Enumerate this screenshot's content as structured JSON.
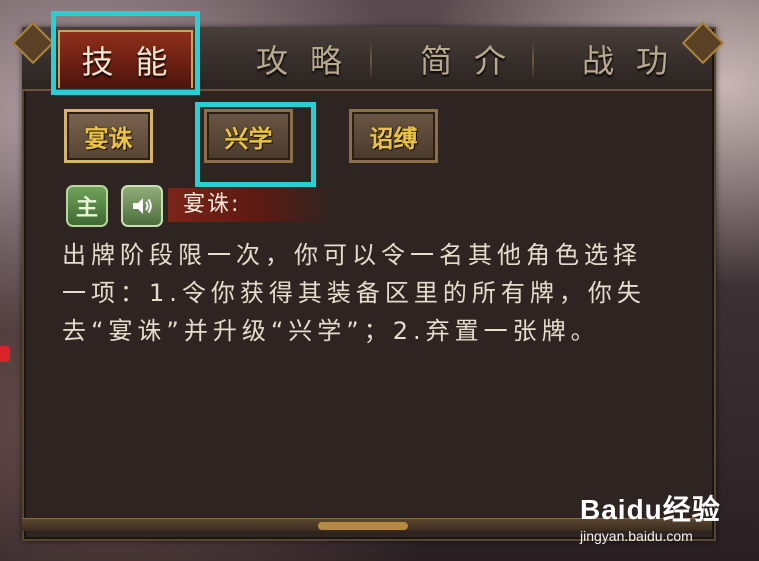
{
  "tabs": [
    {
      "label": "技能",
      "active": true
    },
    {
      "label": "攻略",
      "active": false
    },
    {
      "label": "简介",
      "active": false
    },
    {
      "label": "战功",
      "active": false
    }
  ],
  "skills": [
    {
      "label": "宴诛",
      "selected": true
    },
    {
      "label": "兴学",
      "selected": false
    },
    {
      "label": "诏缚",
      "selected": false
    }
  ],
  "detail": {
    "lord_badge": "主",
    "sound_icon": "speaker-icon",
    "skill_name": "宴诛:",
    "description_lines": [
      "出牌阶段限一次，你可以令一名其他角色选择",
      "一项：1.令你获得其装备区里的所有牌，你失",
      "去“宴诛”并升级“兴学”；2.弃置一张牌。"
    ]
  },
  "watermark": {
    "logo": "Baidu经验",
    "url": "jingyan.baidu.com"
  },
  "colors": {
    "highlight": "#28d0d6",
    "active_tab": "#8e2f1c",
    "skill_text": "#e9c247"
  }
}
